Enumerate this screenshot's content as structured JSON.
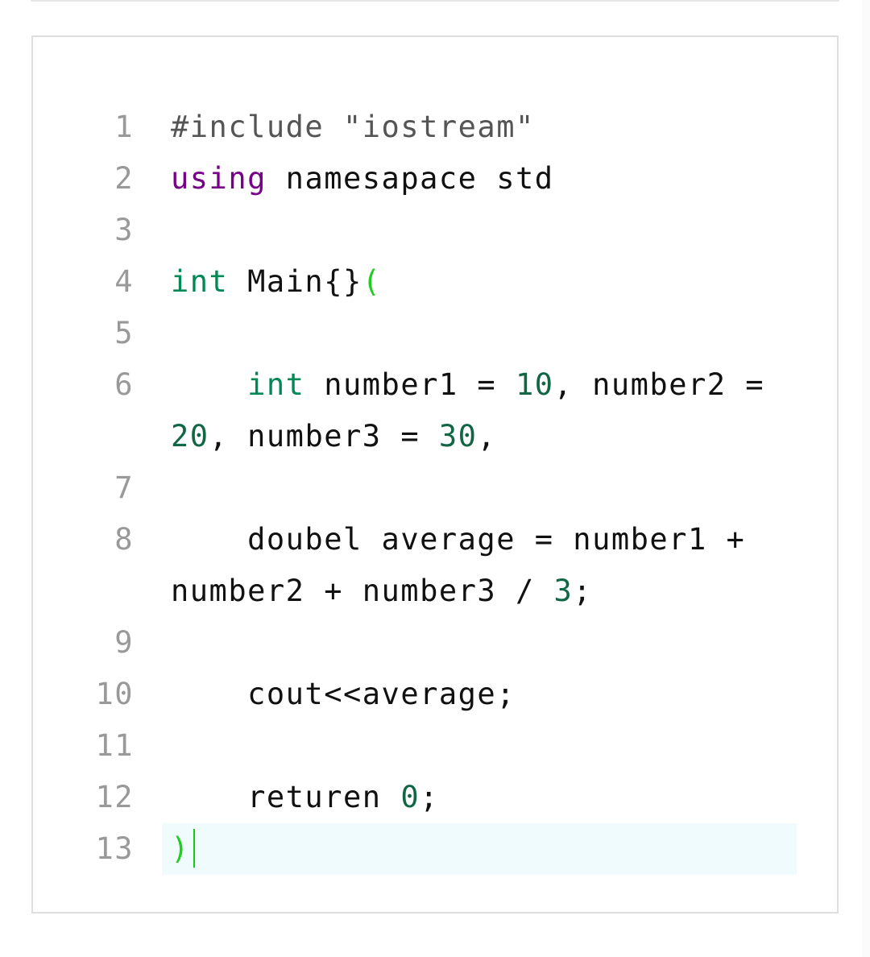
{
  "editor": {
    "colors": {
      "line_number": "#999999",
      "meta": "#555555",
      "keyword": "#770088",
      "type": "#008855",
      "number": "#116644",
      "bracket": "#22cc22",
      "active_line_bg": "#effbfc",
      "border": "#dedede"
    },
    "active_line": 13,
    "lines": [
      {
        "number": "1",
        "tokens": [
          {
            "type": "meta",
            "text": "#include \"iostream\""
          }
        ]
      },
      {
        "number": "2",
        "tokens": [
          {
            "type": "keyword",
            "text": "using"
          },
          {
            "type": "plain",
            "text": " namesapace std"
          }
        ]
      },
      {
        "number": "3",
        "tokens": []
      },
      {
        "number": "4",
        "tokens": [
          {
            "type": "type",
            "text": "int"
          },
          {
            "type": "plain",
            "text": " Main{}"
          },
          {
            "type": "bracket",
            "text": "("
          }
        ]
      },
      {
        "number": "5",
        "tokens": []
      },
      {
        "number": "6",
        "tokens": [
          {
            "type": "plain",
            "text": "    "
          },
          {
            "type": "type",
            "text": "int"
          },
          {
            "type": "plain",
            "text": " number1 = "
          },
          {
            "type": "number",
            "text": "10"
          },
          {
            "type": "plain",
            "text": ", number2 = "
          },
          {
            "type": "number",
            "text": "20"
          },
          {
            "type": "plain",
            "text": ", number3 = "
          },
          {
            "type": "number",
            "text": "30"
          },
          {
            "type": "plain",
            "text": ","
          }
        ]
      },
      {
        "number": "7",
        "tokens": []
      },
      {
        "number": "8",
        "tokens": [
          {
            "type": "plain",
            "text": "    doubel average = number1 + number2 + number3 / "
          },
          {
            "type": "number",
            "text": "3"
          },
          {
            "type": "plain",
            "text": ";"
          }
        ]
      },
      {
        "number": "9",
        "tokens": []
      },
      {
        "number": "10",
        "tokens": [
          {
            "type": "plain",
            "text": "    cout<<average;"
          }
        ]
      },
      {
        "number": "11",
        "tokens": []
      },
      {
        "number": "12",
        "tokens": [
          {
            "type": "plain",
            "text": "    returen "
          },
          {
            "type": "number",
            "text": "0"
          },
          {
            "type": "plain",
            "text": ";"
          }
        ]
      },
      {
        "number": "13",
        "tokens": [
          {
            "type": "bracket",
            "text": ")"
          }
        ]
      }
    ]
  }
}
